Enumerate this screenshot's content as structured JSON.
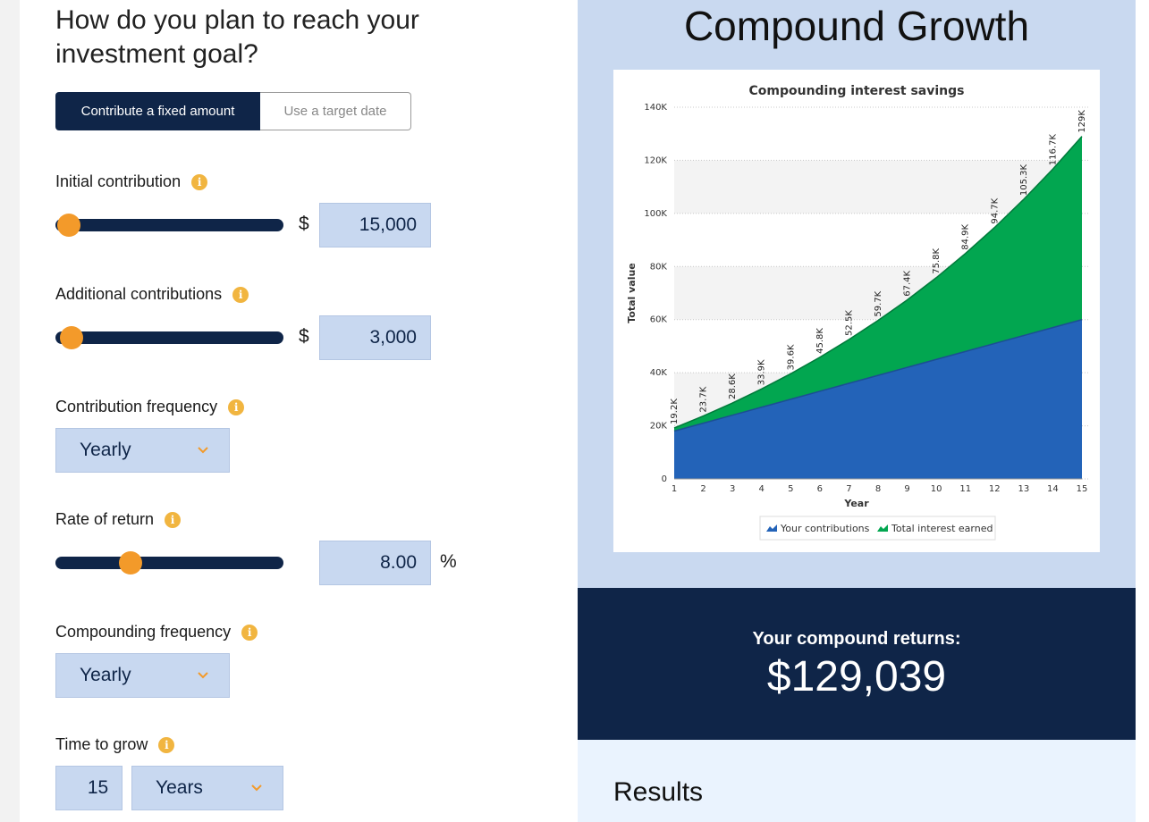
{
  "calculator": {
    "question": "How do you plan to reach your investment goal?",
    "mode_toggle": {
      "active_label": "Contribute a fixed amount",
      "inactive_label": "Use a target date"
    },
    "info_glyph": "i",
    "initial_contribution": {
      "label": "Initial contribution",
      "currency": "$",
      "value": "15,000"
    },
    "additional_contributions": {
      "label": "Additional contributions",
      "currency": "$",
      "value": "3,000"
    },
    "contribution_frequency": {
      "label": "Contribution frequency",
      "selected": "Yearly"
    },
    "rate_of_return": {
      "label": "Rate of return",
      "value": "8.00",
      "unit": "%"
    },
    "compounding_frequency": {
      "label": "Compounding frequency",
      "selected": "Yearly"
    },
    "time_to_grow": {
      "label": "Time to grow",
      "value": "15",
      "unit_selected": "Years"
    },
    "sliders": {
      "initial_level": 0.06,
      "additional_level": 0.07,
      "rate_level": 0.33
    },
    "colors": {
      "navy": "#0f2548",
      "thumb": "#f39a2a",
      "info": "#f1b540",
      "input_bg": "#c8d8f0"
    }
  },
  "results": {
    "heading": "Compound Growth",
    "returns_label": "Your compound returns:",
    "returns_value": "$129,039",
    "results_title": "Results"
  },
  "chart_data": {
    "type": "area",
    "title": "Compounding interest savings",
    "xlabel": "Year",
    "ylabel": "Total value",
    "x": [
      1,
      2,
      3,
      4,
      5,
      6,
      7,
      8,
      9,
      10,
      11,
      12,
      13,
      14,
      15
    ],
    "ylim": [
      0,
      140000
    ],
    "yticks": [
      0,
      20000,
      40000,
      60000,
      80000,
      100000,
      120000,
      140000
    ],
    "ytick_labels": [
      "0",
      "20K",
      "40K",
      "60K",
      "80K",
      "100K",
      "120K",
      "140K"
    ],
    "series": [
      {
        "name": "Your contributions",
        "color": "#2363b8",
        "values": [
          18000,
          21000,
          24000,
          27000,
          30000,
          33000,
          36000,
          39000,
          42000,
          45000,
          48000,
          51000,
          54000,
          57000,
          60000
        ]
      },
      {
        "name": "Total interest earned",
        "color": "#02a650",
        "values": [
          1200,
          2700,
          4600,
          6900,
          9600,
          12800,
          16500,
          20700,
          25400,
          30800,
          36900,
          43700,
          51300,
          59700,
          69039
        ]
      }
    ],
    "totals": [
      19200,
      23700,
      28600,
      33900,
      39600,
      45800,
      52500,
      59700,
      67400,
      75800,
      84900,
      94700,
      105300,
      116700,
      129000
    ],
    "total_labels": [
      "19.2K",
      "23.7K",
      "28.6K",
      "33.9K",
      "39.6K",
      "45.8K",
      "52.5K",
      "59.7K",
      "67.4K",
      "75.8K",
      "84.9K",
      "94.7K",
      "105.3K",
      "116.7K",
      "129K"
    ],
    "grid": true,
    "legend": "bottom"
  }
}
